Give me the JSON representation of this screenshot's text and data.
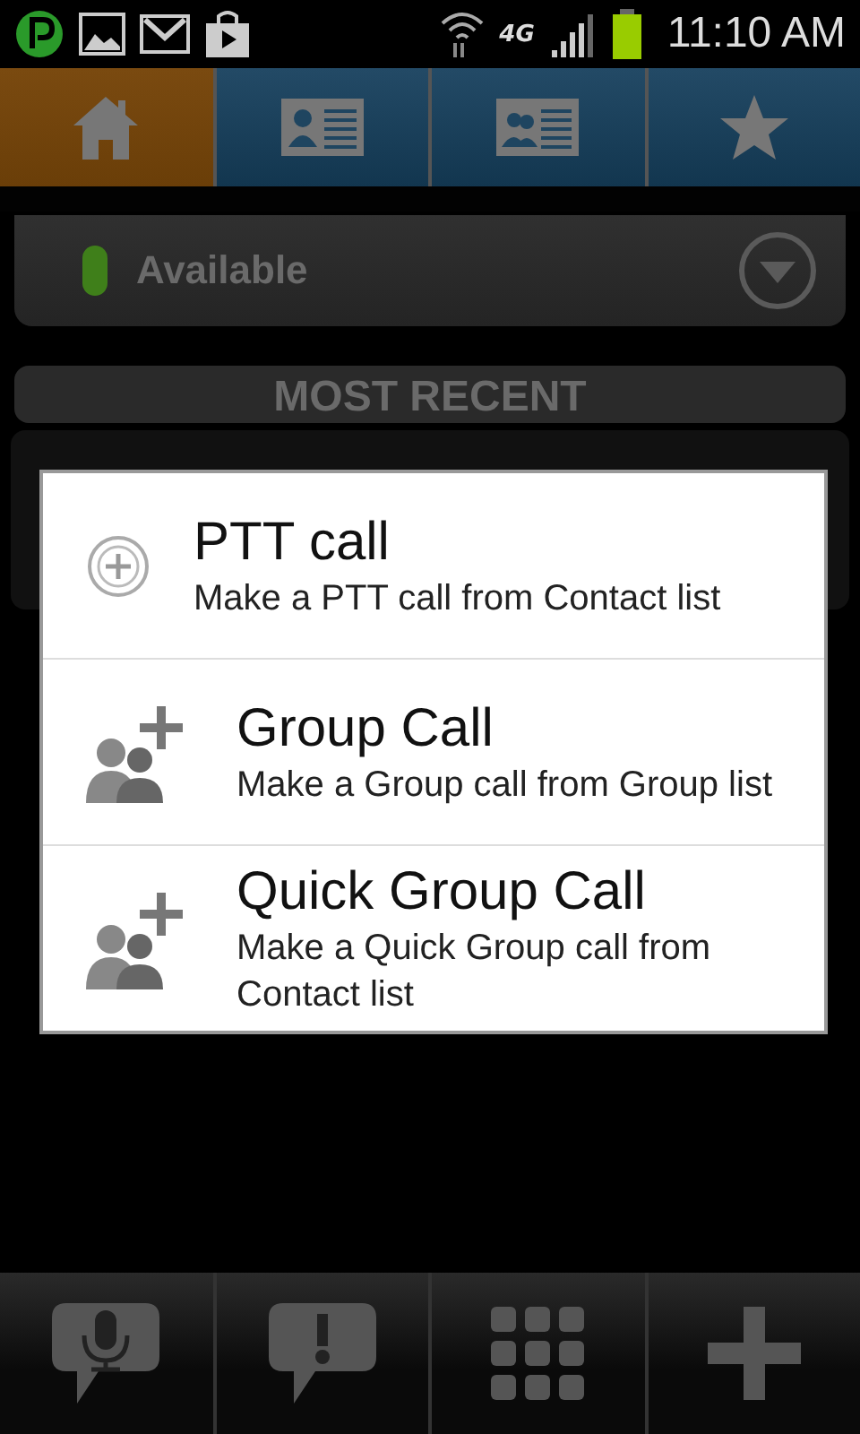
{
  "status_bar": {
    "time": "11:10 AM",
    "network": "4G"
  },
  "tabs": [
    {
      "kind": "home",
      "selected": true
    },
    {
      "kind": "contact",
      "selected": false
    },
    {
      "kind": "group",
      "selected": false
    },
    {
      "kind": "favorite",
      "selected": false
    }
  ],
  "presence": {
    "label": "Available",
    "color": "#3f7f1a"
  },
  "section_header": "MOST RECENT",
  "dialog": {
    "items": [
      {
        "kind": "add",
        "title": "PTT call",
        "subtitle": "Make a PTT call from Contact list"
      },
      {
        "kind": "group-add",
        "title": "Group Call",
        "subtitle": "Make a Group call from Group list"
      },
      {
        "kind": "group-add",
        "title": "Quick Group Call",
        "subtitle": "Make a Quick Group call from Contact list"
      }
    ]
  },
  "bottom_bar": [
    {
      "kind": "talk"
    },
    {
      "kind": "alert"
    },
    {
      "kind": "dialpad"
    },
    {
      "kind": "add"
    }
  ]
}
